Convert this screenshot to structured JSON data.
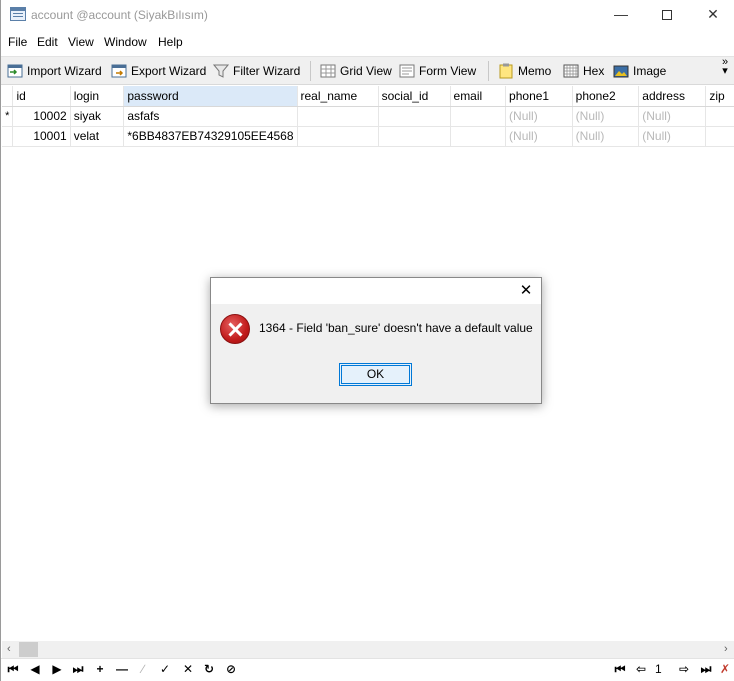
{
  "window": {
    "title": "account @account (SiyakBılısım)",
    "controls": {
      "minimize": "—",
      "close": "✕"
    }
  },
  "menu": [
    "File",
    "Edit",
    "View",
    "Window",
    "Help"
  ],
  "toolbar": {
    "import_wizard": "Import Wizard",
    "export_wizard": "Export Wizard",
    "filter_wizard": "Filter Wizard",
    "grid_view": "Grid View",
    "form_view": "Form View",
    "memo": "Memo",
    "hex": "Hex",
    "image": "Image",
    "more": "»"
  },
  "grid": {
    "columns": [
      "id",
      "login",
      "password",
      "real_name",
      "social_id",
      "email",
      "phone1",
      "phone2",
      "address",
      "zip"
    ],
    "active_column": "password",
    "rows": [
      {
        "marker": "*",
        "cells": [
          "10002",
          "siyak",
          "asfafs",
          "",
          "",
          "",
          "(Null)",
          "(Null)",
          "(Null)",
          ""
        ]
      },
      {
        "marker": "",
        "cells": [
          "10001",
          "velat",
          "*6BB4837EB74329105EE4568",
          "",
          "",
          "",
          "(Null)",
          "(Null)",
          "(Null)",
          ""
        ]
      }
    ]
  },
  "navbar": {
    "first": "⏮",
    "prev": "◀",
    "next": "▶",
    "last": "⏭",
    "add": "+",
    "delete": "—",
    "edit": "∕",
    "apply": "✓",
    "cancel": "✕",
    "refresh": "↻",
    "stop": "⊘",
    "page_first": "⏮",
    "page_prev": "⇦",
    "page_number": "1",
    "page_next": "⇨",
    "page_last": "⏭",
    "settings": "✗"
  },
  "dialog": {
    "close": "✕",
    "message": "1364 - Field 'ban_sure' doesn't have a default value",
    "ok_label": "OK"
  },
  "scrollbar": {
    "left": "‹",
    "right": "›"
  }
}
